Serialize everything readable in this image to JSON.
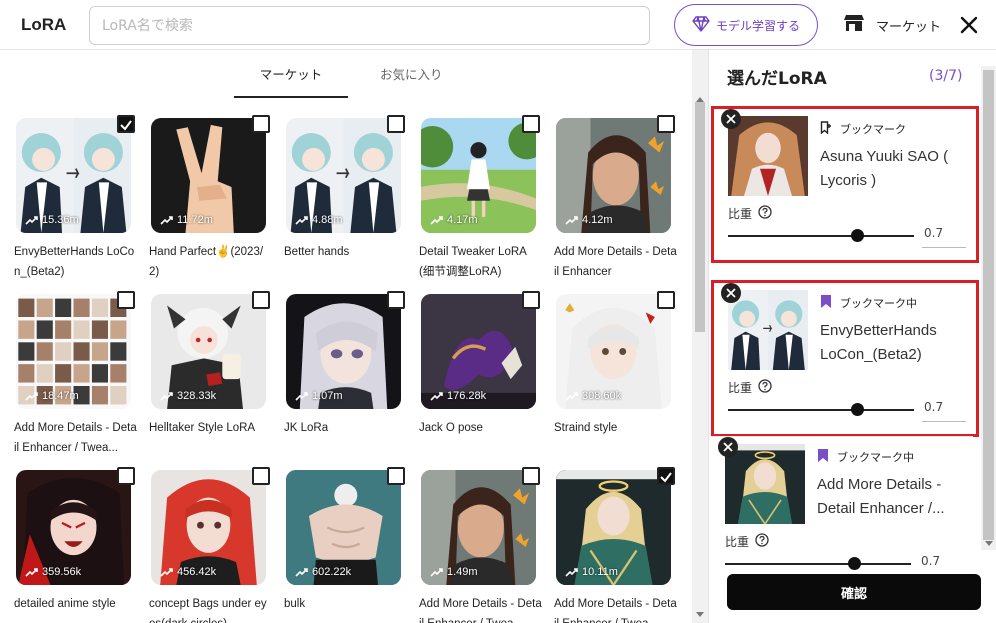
{
  "header": {
    "logo": "LoRA",
    "search_placeholder": "LoRA名で検索",
    "train_label": "モデル学習する",
    "market_label": "マーケット"
  },
  "tabs": [
    {
      "label": "マーケット",
      "active": true
    },
    {
      "label": "お気に入り",
      "active": false
    }
  ],
  "cards": [
    {
      "title": "EnvyBetterHands LoCon_(Beta2)",
      "count": "15.36m",
      "checked": true,
      "thumb": "anime-hands"
    },
    {
      "title": "Hand Parfect✌(2023/2)",
      "count": "11.72m",
      "checked": false,
      "thumb": "peace-hand"
    },
    {
      "title": "Better hands",
      "count": "4.88m",
      "checked": false,
      "thumb": "anime-hands"
    },
    {
      "title": "Detail Tweaker LoRA (细节调整LoRA)",
      "count": "4.17m",
      "checked": false,
      "thumb": "park-girl"
    },
    {
      "title": "Add More Details - Detail Enhancer",
      "count": "4.12m",
      "checked": false,
      "thumb": "woman-butterfly"
    },
    {
      "title": "Add More Details - Detail Enhancer / Twea...",
      "count": "18.47m",
      "checked": false,
      "thumb": "grid-collage"
    },
    {
      "title": "Helltaker Style LoRA",
      "count": "328.33k",
      "checked": false,
      "thumb": "white-hair-cup"
    },
    {
      "title": "JK LoRa",
      "count": "1.07m",
      "checked": false,
      "thumb": "silver-girl"
    },
    {
      "title": "Jack O pose",
      "count": "176.28k",
      "checked": false,
      "thumb": "purple-pose"
    },
    {
      "title": "Straind style",
      "count": "308.60k",
      "checked": false,
      "thumb": "white-girl"
    },
    {
      "title": "detailed anime style",
      "count": "359.56k",
      "checked": false,
      "thumb": "dark-anime"
    },
    {
      "title": "concept Bags under eyes(dark circles)",
      "count": "456.42k",
      "checked": false,
      "thumb": "redhead"
    },
    {
      "title": "bulk",
      "count": "602.22k",
      "checked": false,
      "thumb": "muscle"
    },
    {
      "title": "Add More Details - Detail Enhancer / Twea...",
      "count": "1.49m",
      "checked": false,
      "thumb": "woman-butterfly"
    },
    {
      "title": "Add More Details - Detail Enhancer / Twea...",
      "count": "10.11m",
      "checked": true,
      "thumb": "angel"
    }
  ],
  "panel": {
    "title": "選んだLoRA",
    "count": "(3/7)",
    "weight_label": "比重",
    "confirm_label": "確認",
    "selected": [
      {
        "name": "Asuna Yuuki SAO ( Lycoris )",
        "bookmark": "ブックマーク",
        "bookmarked": false,
        "weight": "0.7",
        "thumb": "asuna"
      },
      {
        "name": "EnvyBetterHands LoCon_(Beta2)",
        "bookmark": "ブックマーク中",
        "bookmarked": true,
        "weight": "0.7",
        "thumb": "anime-hands"
      },
      {
        "name": "Add More Details - Detail Enhancer /...",
        "bookmark": "ブックマーク中",
        "bookmarked": true,
        "weight": "0.7",
        "thumb": "angel"
      }
    ]
  },
  "colors": {
    "accent": "#7b4ec9",
    "highlight": "#d81e26"
  }
}
